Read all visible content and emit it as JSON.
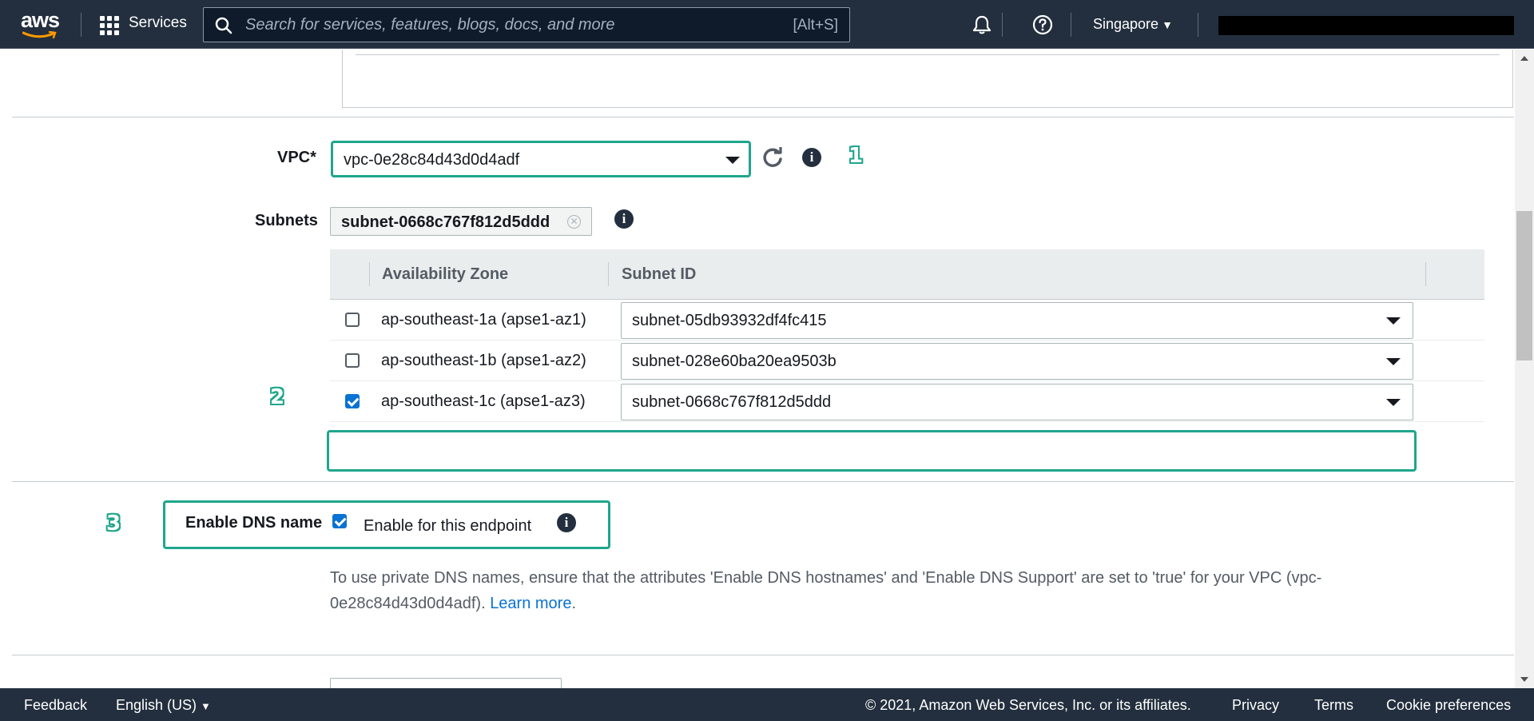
{
  "topnav": {
    "logo_text": "aws",
    "services_label": "Services",
    "search_placeholder": "Search for services, features, blogs, docs, and more",
    "search_shortcut": "[Alt+S]",
    "region": "Singapore",
    "bg_color": "#232f3e"
  },
  "vpc": {
    "label": "VPC*",
    "value": "vpc-0e28c84d43d0d4adf",
    "step": "1"
  },
  "subnets": {
    "label": "Subnets",
    "token": "subnet-0668c767f812d5ddd",
    "table": {
      "columns": [
        "Availability Zone",
        "Subnet ID"
      ],
      "rows": [
        {
          "checked": false,
          "az": "ap-southeast-1a (apse1-az1)",
          "subnet": "subnet-05db93932df4fc415"
        },
        {
          "checked": false,
          "az": "ap-southeast-1b (apse1-az2)",
          "subnet": "subnet-028e60ba20ea9503b"
        },
        {
          "checked": true,
          "az": "ap-southeast-1c (apse1-az3)",
          "subnet": "subnet-0668c767f812d5ddd"
        }
      ]
    },
    "step": "2"
  },
  "dns": {
    "label": "Enable DNS name",
    "checkbox_label": "Enable for this endpoint",
    "checked": true,
    "step": "3",
    "help_text": "To use private DNS names, ensure that the attributes 'Enable DNS hostnames' and 'Enable DNS Support' are set to 'true' for your VPC (vpc-0e28c84d43d0d4adf).",
    "learn_more": "Learn more",
    "period": "."
  },
  "footer": {
    "feedback": "Feedback",
    "language": "English (US)",
    "copyright": "© 2021, Amazon Web Services, Inc. or its affiliates.",
    "privacy": "Privacy",
    "terms": "Terms",
    "cookie": "Cookie preferences"
  },
  "colors": {
    "highlight": "#1fa68d",
    "link": "#0972d3",
    "checkbox": "#0972d3"
  },
  "icons": [
    "grid-icon",
    "search-icon",
    "bell-icon",
    "help-icon",
    "refresh-icon",
    "info-icon",
    "caret-down-icon"
  ]
}
